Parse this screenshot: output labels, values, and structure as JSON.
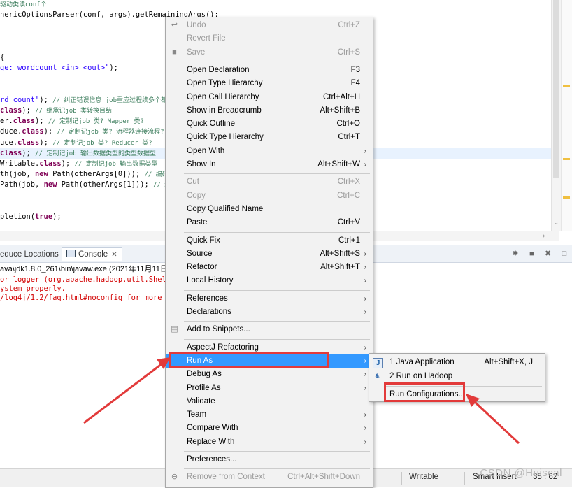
{
  "editor": {
    "lines": [
      {
        "segments": [
          {
            "t": "驱动类读conf个",
            "c": "c-com"
          }
        ]
      },
      {
        "segments": [
          {
            "t": "nericOptionsParser(conf, args).getRemainingArgs();",
            "c": ""
          }
        ]
      },
      {
        "segments": [
          {
            "t": "",
            "c": ""
          }
        ]
      },
      {
        "segments": [
          {
            "t": "",
            "c": ""
          }
        ]
      },
      {
        "segments": [
          {
            "t": "",
            "c": ""
          }
        ]
      },
      {
        "segments": [
          {
            "t": "{",
            "c": ""
          }
        ]
      },
      {
        "segments": [
          {
            "t": "ge: wordcount <in> <out>\"",
            "c": "c-str"
          },
          {
            "t": ");",
            "c": ""
          }
        ]
      },
      {
        "segments": [
          {
            "t": "",
            "c": ""
          }
        ]
      },
      {
        "segments": [
          {
            "t": "",
            "c": ""
          }
        ]
      },
      {
        "segments": [
          {
            "t": "rd count\"",
            "c": "c-str"
          },
          {
            "t": "); ",
            "c": ""
          },
          {
            "t": "// 纠正错误信息 job重应过程续多个都是",
            "c": "c-com"
          }
        ]
      },
      {
        "segments": [
          {
            "t": "class",
            "c": "c-kw"
          },
          {
            "t": "); ",
            "c": ""
          },
          {
            "t": "// 继承记job 类转换目结",
            "c": "c-com"
          }
        ]
      },
      {
        "segments": [
          {
            "t": "er.",
            "c": ""
          },
          {
            "t": "class",
            "c": "c-kw"
          },
          {
            "t": "); ",
            "c": ""
          },
          {
            "t": "// 定制记job 类? Mapper 类?",
            "c": "c-com"
          }
        ]
      },
      {
        "segments": [
          {
            "t": "duce.",
            "c": ""
          },
          {
            "t": "class",
            "c": "c-kw"
          },
          {
            "t": "); ",
            "c": ""
          },
          {
            "t": "// 定制记job 类? 流程器连接流程?",
            "c": "c-com"
          }
        ]
      },
      {
        "segments": [
          {
            "t": "uce.",
            "c": ""
          },
          {
            "t": "class",
            "c": "c-kw"
          },
          {
            "t": "); ",
            "c": ""
          },
          {
            "t": "// 定制记job 类? Reducer 类?",
            "c": "c-com"
          }
        ]
      },
      {
        "segments": [
          {
            "t": "class",
            "c": "c-kw"
          },
          {
            "t": "); ",
            "c": ""
          },
          {
            "t": "// 定制记job 输出数据类型的类型数据型",
            "c": "c-com"
          }
        ],
        "highlight": true
      },
      {
        "segments": [
          {
            "t": "Writable.",
            "c": ""
          },
          {
            "t": "class",
            "c": "c-kw"
          },
          {
            "t": "); ",
            "c": ""
          },
          {
            "t": "// 定制记job 输出数据类型",
            "c": "c-com"
          }
        ]
      },
      {
        "segments": [
          {
            "t": "th(job, ",
            "c": ""
          },
          {
            "t": "new",
            "c": "c-kw"
          },
          {
            "t": " Path(otherArgs[0])); ",
            "c": ""
          },
          {
            "t": "// 编码输",
            "c": "c-com"
          }
        ]
      },
      {
        "segments": [
          {
            "t": "Path(job, ",
            "c": ""
          },
          {
            "t": "new",
            "c": "c-kw"
          },
          {
            "t": " Path(otherArgs[1])); ",
            "c": ""
          },
          {
            "t": "// 编码",
            "c": "c-com"
          }
        ]
      },
      {
        "segments": [
          {
            "t": "",
            "c": ""
          }
        ]
      },
      {
        "segments": [
          {
            "t": "",
            "c": ""
          }
        ]
      },
      {
        "segments": [
          {
            "t": "pletion(",
            "c": ""
          },
          {
            "t": "true",
            "c": "c-kw"
          },
          {
            "t": ");",
            "c": ""
          }
        ]
      }
    ]
  },
  "console": {
    "tabs": [
      {
        "label": "educe Locations"
      },
      {
        "label": "Console",
        "active": true
      }
    ],
    "header_line": "ava\\jdk1.8.0_261\\bin\\javaw.exe (2021年11月11日",
    "lines": [
      "or logger (org.apache.hadoop.util.Shell",
      "ystem properly.",
      "/log4j/1.2/faq.html#noconfig for more i"
    ]
  },
  "context_menu": {
    "items": [
      {
        "label": "Undo",
        "shortcut": "Ctrl+Z",
        "disabled": true,
        "icon": "undo-icon"
      },
      {
        "label": "Revert File",
        "disabled": true
      },
      {
        "label": "Save",
        "shortcut": "Ctrl+S",
        "disabled": true,
        "icon": "save-icon"
      },
      {
        "sep": true
      },
      {
        "label": "Open Declaration",
        "shortcut": "F3"
      },
      {
        "label": "Open Type Hierarchy",
        "shortcut": "F4"
      },
      {
        "label": "Open Call Hierarchy",
        "shortcut": "Ctrl+Alt+H"
      },
      {
        "label": "Show in Breadcrumb",
        "shortcut": "Alt+Shift+B"
      },
      {
        "label": "Quick Outline",
        "shortcut": "Ctrl+O"
      },
      {
        "label": "Quick Type Hierarchy",
        "shortcut": "Ctrl+T"
      },
      {
        "label": "Open With",
        "submenu": true
      },
      {
        "label": "Show In",
        "shortcut": "Alt+Shift+W",
        "submenu": true
      },
      {
        "sep": true
      },
      {
        "label": "Cut",
        "shortcut": "Ctrl+X",
        "disabled": true
      },
      {
        "label": "Copy",
        "shortcut": "Ctrl+C",
        "disabled": true
      },
      {
        "label": "Copy Qualified Name"
      },
      {
        "label": "Paste",
        "shortcut": "Ctrl+V"
      },
      {
        "sep": true
      },
      {
        "label": "Quick Fix",
        "shortcut": "Ctrl+1"
      },
      {
        "label": "Source",
        "shortcut": "Alt+Shift+S",
        "submenu": true
      },
      {
        "label": "Refactor",
        "shortcut": "Alt+Shift+T",
        "submenu": true
      },
      {
        "label": "Local History",
        "submenu": true
      },
      {
        "sep": true
      },
      {
        "label": "References",
        "submenu": true
      },
      {
        "label": "Declarations",
        "submenu": true
      },
      {
        "sep": true
      },
      {
        "label": "Add to Snippets...",
        "icon": "snippets-icon"
      },
      {
        "sep": true
      },
      {
        "label": "AspectJ Refactoring",
        "submenu": true
      },
      {
        "label": "Run As",
        "submenu": true,
        "highlighted": true
      },
      {
        "label": "Debug As",
        "submenu": true
      },
      {
        "label": "Profile As",
        "submenu": true
      },
      {
        "label": "Validate"
      },
      {
        "label": "Team",
        "submenu": true
      },
      {
        "label": "Compare With",
        "submenu": true
      },
      {
        "label": "Replace With",
        "submenu": true
      },
      {
        "sep": true
      },
      {
        "label": "Preferences..."
      },
      {
        "sep": true
      },
      {
        "label": "Remove from Context",
        "shortcut": "Ctrl+Alt+Shift+Down",
        "disabled": true,
        "icon": "remove-context-icon"
      }
    ]
  },
  "run_as_submenu": {
    "items": [
      {
        "label": "1 Java Application",
        "shortcut": "Alt+Shift+X, J",
        "icon": "java-app-icon"
      },
      {
        "label": "2 Run on Hadoop",
        "icon": "hadoop-elephant-icon"
      },
      {
        "sep": true
      },
      {
        "label": "Run Configurations..."
      }
    ]
  },
  "status_bar": {
    "writable": "Writable",
    "insert_mode": "Smart Insert",
    "position": "35 : 62"
  },
  "watermark": "CSDN @Huiscal",
  "annotation_color": "#e23a3a",
  "highlight_color": "#3399ff"
}
